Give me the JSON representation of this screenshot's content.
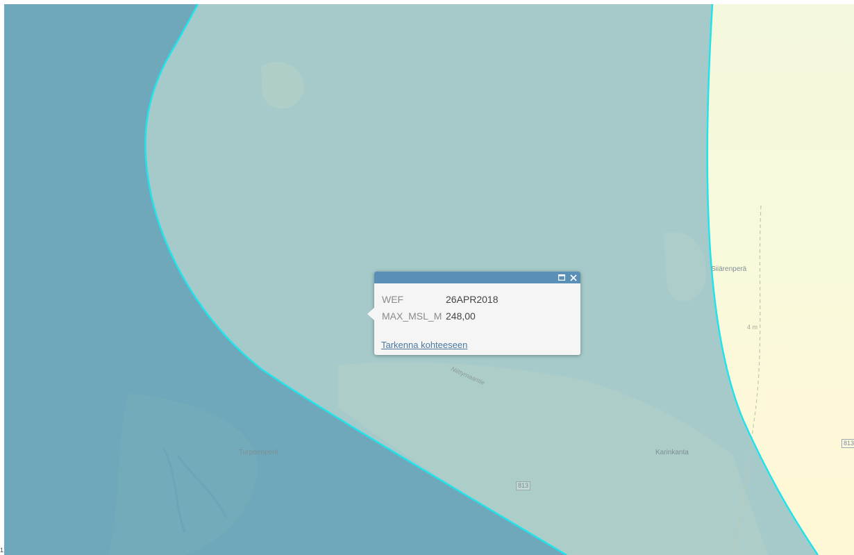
{
  "map": {
    "places": {
      "turpeenpera": "Turpeenperä",
      "karinkanta": "Karinkanta",
      "siiarenpera": "Siiärenperä"
    },
    "road_label": "Niittymaantie",
    "road_shield_1": "813",
    "road_shield_2": "813",
    "elevation_label": "4 m",
    "colors": {
      "outer_zone": "#6ea8bb",
      "inner_zone": "#a6cbcc",
      "boundary": "#22e3eb",
      "east_zone": "#fff8d8"
    }
  },
  "popup": {
    "attributes": [
      {
        "name": "WEF",
        "value": "26APR2018"
      },
      {
        "name": "MAX_MSL_M",
        "value": "248,00"
      }
    ],
    "zoom_link": "Tarkenna kohteeseen",
    "icons": {
      "maximize": "maximize-icon",
      "close": "close-icon"
    }
  },
  "corner_mark": "1"
}
